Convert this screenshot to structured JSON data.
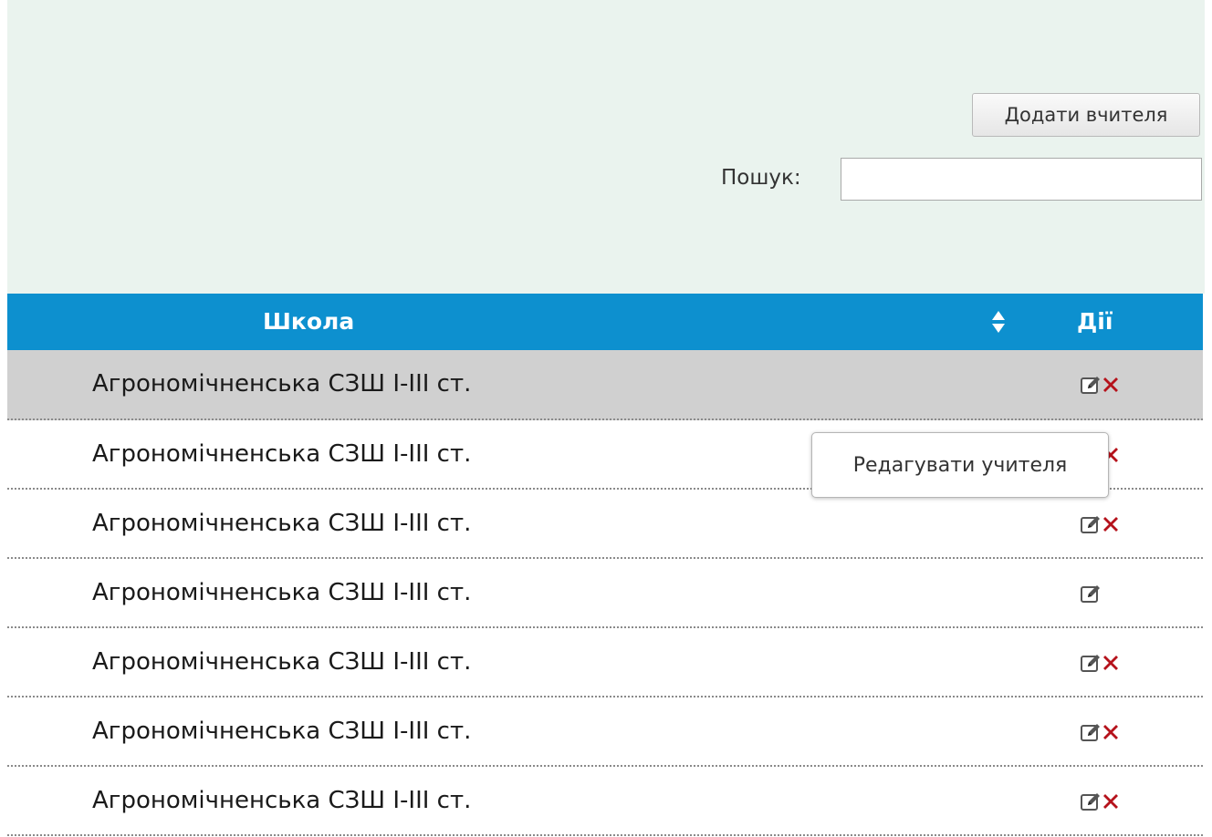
{
  "toolbar": {
    "add_teacher_label": "Додати вчителя",
    "search_label": "Пошук:",
    "search_value": ""
  },
  "table": {
    "columns": {
      "school": "Школа",
      "actions": "Дії"
    },
    "rows": [
      {
        "school": "Агрономічненська СЗШ І-ІІІ ст.",
        "can_edit": true,
        "can_delete": true,
        "highlighted": true
      },
      {
        "school": "Агрономічненська СЗШ І-ІІІ ст.",
        "can_edit": true,
        "can_delete": true,
        "highlighted": false
      },
      {
        "school": "Агрономічненська СЗШ І-ІІІ ст.",
        "can_edit": true,
        "can_delete": true,
        "highlighted": false
      },
      {
        "school": "Агрономічненська СЗШ І-ІІІ ст.",
        "can_edit": true,
        "can_delete": false,
        "highlighted": false
      },
      {
        "school": "Агрономічненська СЗШ І-ІІІ ст.",
        "can_edit": true,
        "can_delete": true,
        "highlighted": false
      },
      {
        "school": "Агрономічненська СЗШ І-ІІІ ст.",
        "can_edit": true,
        "can_delete": true,
        "highlighted": false
      },
      {
        "school": "Агрономічненська СЗШ І-ІІІ ст.",
        "can_edit": true,
        "can_delete": true,
        "highlighted": false
      }
    ]
  },
  "tooltip": {
    "text": "Редагувати учителя"
  },
  "icons": {
    "edit": "edit-icon",
    "delete": "delete-icon",
    "sort": "sort-icon"
  },
  "colors": {
    "header_bg": "#0d90cf",
    "panel_bg": "#eaf3ee",
    "highlight_row_bg": "#d0d0d0",
    "delete_red": "#b5121b"
  }
}
